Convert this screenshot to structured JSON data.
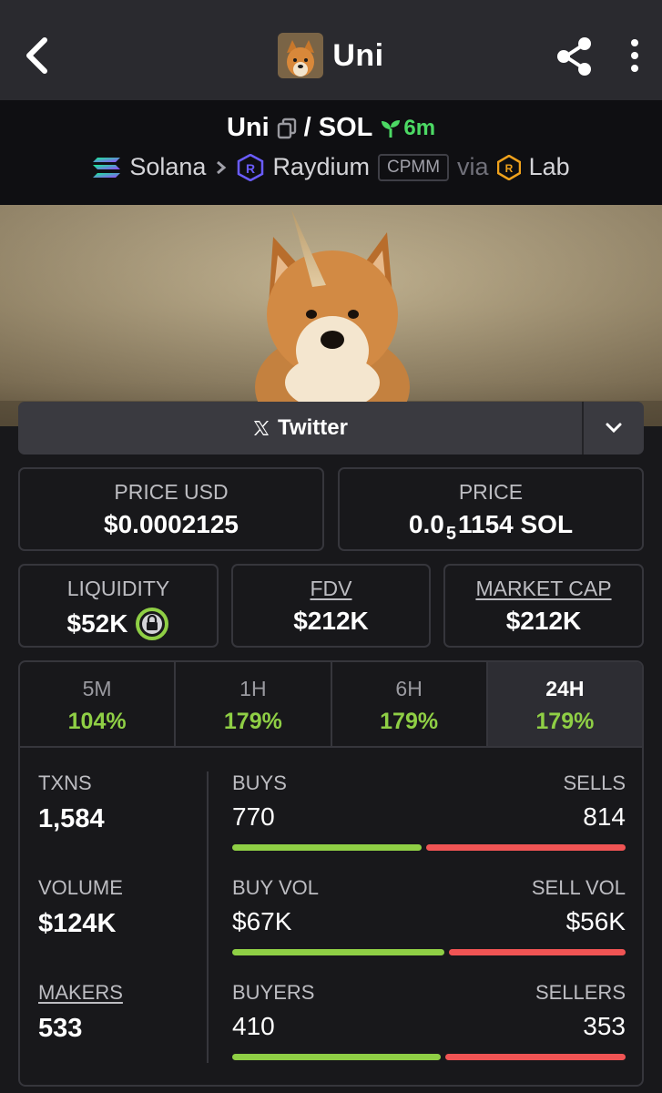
{
  "header": {
    "title": "Uni",
    "avatar_alt": "Uni token avatar",
    "back_icon": "chevron-left-icon",
    "share_icon": "share-icon",
    "more_icon": "more-vertical-icon"
  },
  "pair": {
    "base": "Uni",
    "separator": "/",
    "quote": "SOL",
    "age": "6m",
    "chain": "Solana",
    "dex": "Raydium",
    "pool_type": "CPMM",
    "via_label": "via",
    "launchpad": "Lab"
  },
  "social": {
    "twitter_label": "Twitter"
  },
  "metrics": {
    "price_usd_label": "PRICE USD",
    "price_usd_value": "$0.0002125",
    "price_label": "PRICE",
    "price_prefix": "0.0",
    "price_subscript": "5",
    "price_suffix": "1154 SOL",
    "liquidity_label": "LIQUIDITY",
    "liquidity_value": "$52K",
    "fdv_label": "FDV",
    "fdv_value": "$212K",
    "mcap_label": "MARKET CAP",
    "mcap_value": "$212K"
  },
  "tabs": [
    {
      "label": "5M",
      "value": "104%"
    },
    {
      "label": "1H",
      "value": "179%"
    },
    {
      "label": "6H",
      "value": "179%"
    },
    {
      "label": "24H",
      "value": "179%",
      "active": true
    }
  ],
  "stats": {
    "txns_label": "TXNS",
    "txns_value": "1,584",
    "volume_label": "VOLUME",
    "volume_value": "$124K",
    "makers_label": "MAKERS",
    "makers_value": "533",
    "buys_label": "BUYS",
    "buys_value": "770",
    "sells_label": "SELLS",
    "sells_value": "814",
    "buys_ratio": 0.486,
    "buyvol_label": "BUY VOL",
    "buyvol_value": "$67K",
    "sellvol_label": "SELL VOL",
    "sellvol_value": "$56K",
    "buyvol_ratio": 0.545,
    "buyers_label": "BUYERS",
    "buyers_value": "410",
    "sellers_label": "SELLERS",
    "sellers_value": "353",
    "buyers_ratio": 0.537
  },
  "colors": {
    "positive": "#8fcf45",
    "negative": "#f05454",
    "new_pair": "#4cd964"
  }
}
